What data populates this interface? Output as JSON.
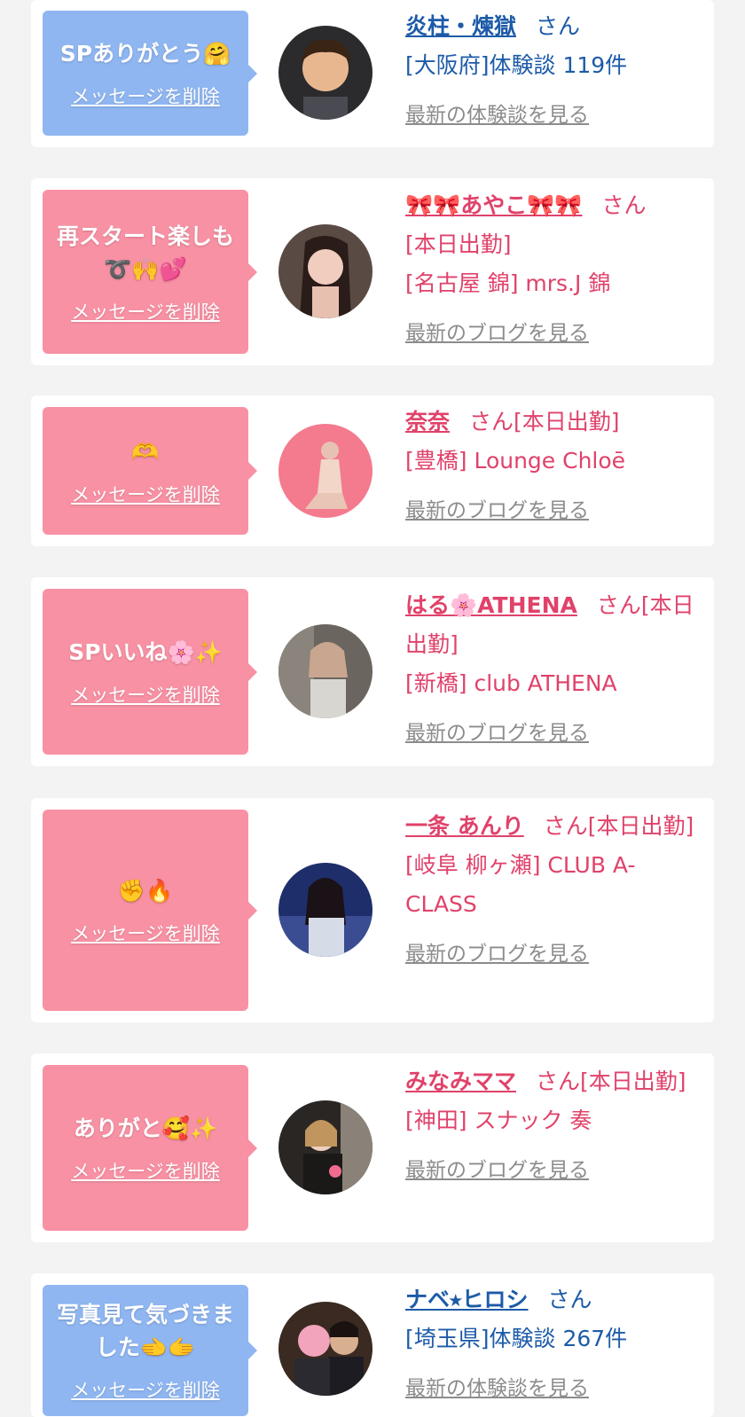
{
  "cards": [
    {
      "message": "SPありがとう🤗",
      "delete_label": "メッセージを削除",
      "name": "炎柱・煉獄",
      "honorific": "さん",
      "line1": "[大阪府]体験談 119件",
      "line2": "",
      "link": "最新の体験談を見る",
      "theme": "blue"
    },
    {
      "message": "再スタート楽しも➰🙌💕",
      "delete_label": "メッセージを削除",
      "name": "🎀🎀あやこ🎀🎀",
      "honorific": "さん",
      "line1": "[本日出勤]",
      "line2": "[名古屋 錦] mrs.J 錦",
      "link": "最新のブログを見る",
      "theme": "pink"
    },
    {
      "message": "🫶",
      "delete_label": "メッセージを削除",
      "name": "奈奈",
      "honorific": "さん",
      "line1": "[本日出勤]",
      "line2": "[豊橋] Lounge Chloē",
      "link": "最新のブログを見る",
      "theme": "pink"
    },
    {
      "message": "SPいいね🌸✨",
      "delete_label": "メッセージを削除",
      "name": "はる🌸ATHENA",
      "honorific": "さん",
      "line1": "[本日出勤]",
      "line2": "[新橋] club ATHENA",
      "link": "最新のブログを見る",
      "theme": "pink"
    },
    {
      "message": "✊🔥",
      "delete_label": "メッセージを削除",
      "name": "一条 あんり",
      "honorific": "さん",
      "line1": "[本日出勤]",
      "line2": "[岐阜 柳ヶ瀬] CLUB A-CLASS",
      "link": "最新のブログを見る",
      "theme": "pink"
    },
    {
      "message": "ありがと🥰✨",
      "delete_label": "メッセージを削除",
      "name": "みなみママ",
      "honorific": "さん",
      "line1": "[本日出勤]",
      "line2": "[神田] スナック 奏",
      "link": "最新のブログを見る",
      "theme": "pink"
    },
    {
      "message": "写真見て気づきました🫲🫱",
      "delete_label": "メッセージを削除",
      "name": "ナベ⭑ヒロシ",
      "honorific": "さん",
      "line1": "[埼玉県]体験談 267件",
      "line2": "",
      "link": "最新の体験談を見る",
      "theme": "blue"
    }
  ],
  "colors": {
    "blue_bubble": "#8fb6f1",
    "pink_bubble": "#f891a4",
    "blue_text": "#1d5ba8",
    "pink_text": "#e0426a"
  }
}
